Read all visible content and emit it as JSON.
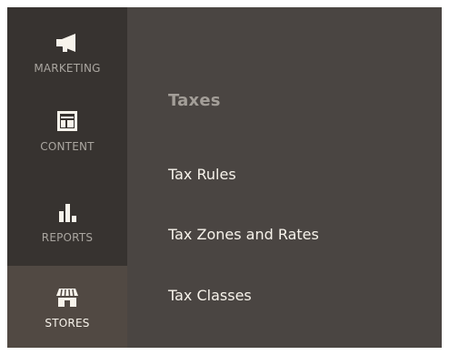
{
  "sidebar": {
    "items": [
      {
        "label": "MARKETING",
        "icon": "megaphone-icon",
        "active": false
      },
      {
        "label": "CONTENT",
        "icon": "layout-icon",
        "active": false
      },
      {
        "label": "REPORTS",
        "icon": "bar-chart-icon",
        "active": false
      },
      {
        "label": "STORES",
        "icon": "storefront-icon",
        "active": true
      }
    ]
  },
  "flyout": {
    "section_title": "Taxes",
    "links": [
      {
        "label": "Tax Rules"
      },
      {
        "label": "Tax Zones and Rates"
      },
      {
        "label": "Tax Classes"
      }
    ]
  },
  "colors": {
    "sidebar_bg": "#373330",
    "sidebar_active_bg": "#514943",
    "flyout_bg": "#4a4542",
    "text_light": "#f7f3eb",
    "text_muted": "#aaa6a0",
    "section_title": "#a39e98"
  }
}
